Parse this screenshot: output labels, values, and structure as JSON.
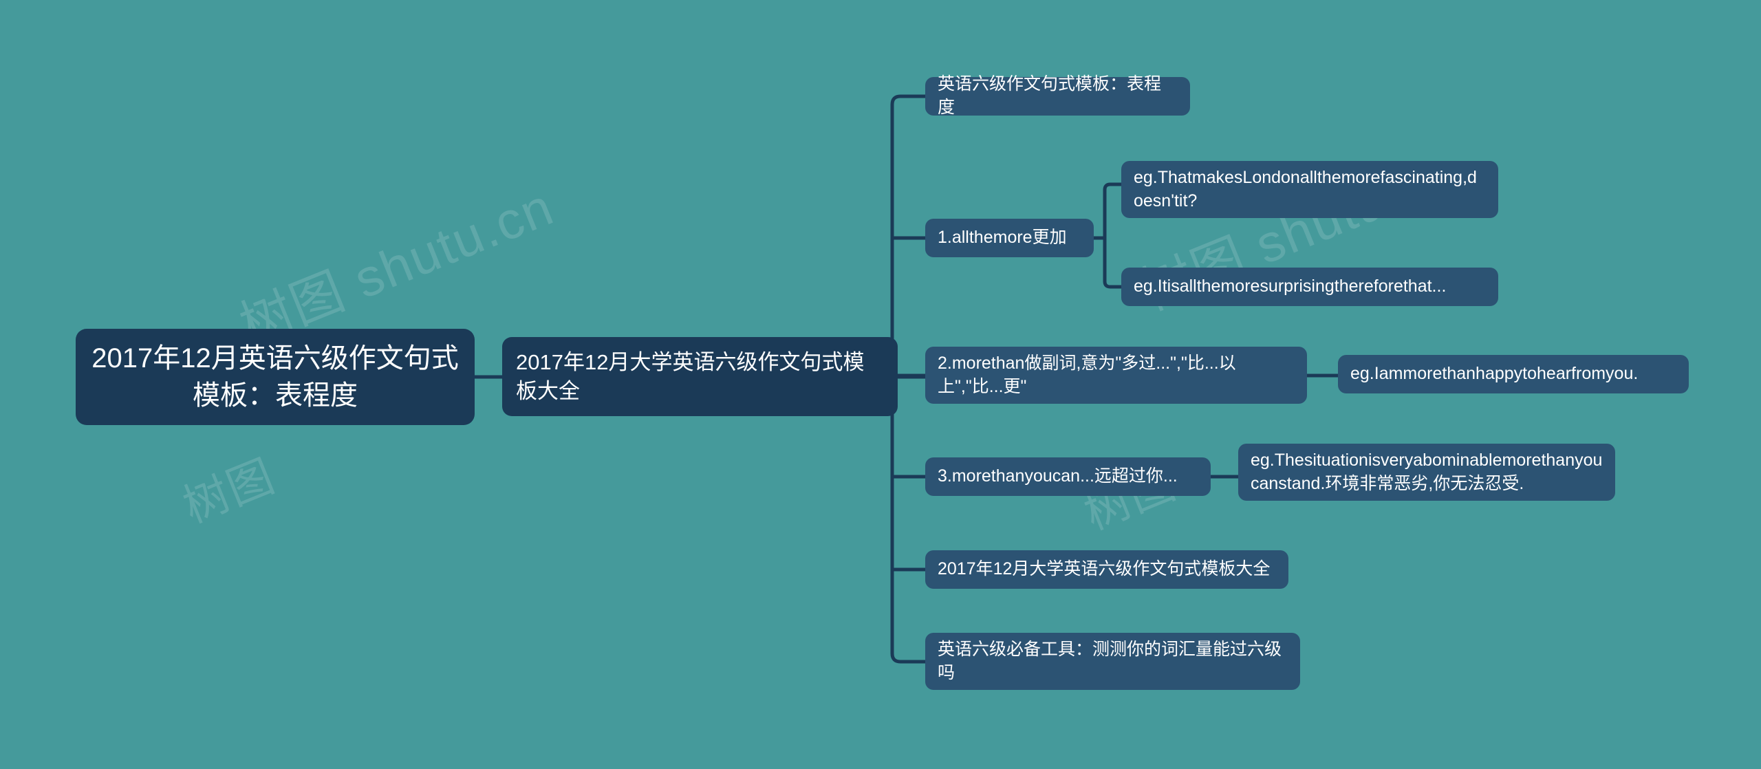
{
  "canvas": {
    "background_color": "#459a9b",
    "root_node_color": "#1b3a57",
    "branch_node_color": "#2c5373",
    "connector_color": "#1b3a57",
    "text_color": "#ffffff"
  },
  "watermark": {
    "text_cn": "树图",
    "text_en": "shutu.cn",
    "full": "树图 shutu.cn"
  },
  "mindmap": {
    "type": "mindmap",
    "root": {
      "id": "root",
      "label": "2017年12月英语六级作文句式模板：表程度"
    },
    "level2": {
      "id": "l2",
      "label": "2017年12月大学英语六级作文句式模板大全"
    },
    "branches": [
      {
        "id": "b1",
        "label": "英语六级作文句式模板：表程度",
        "children": []
      },
      {
        "id": "b2",
        "label": "1.allthemore更加",
        "children": [
          {
            "id": "b2c1",
            "label": "eg.ThatmakesLondonallthemorefascinating,doesn'tit?"
          },
          {
            "id": "b2c2",
            "label": "eg.Itisallthemoresurprisingthereforethat..."
          }
        ]
      },
      {
        "id": "b3",
        "label": "2.morethan做副词,意为\"多过...\",\"比...以上\",\"比...更\"",
        "children": [
          {
            "id": "b3c1",
            "label": "eg.Iammorethanhappytohearfromyou."
          }
        ]
      },
      {
        "id": "b4",
        "label": "3.morethanyoucan...远超过你...",
        "children": [
          {
            "id": "b4c1",
            "label": "eg.Thesituationisveryabominablemorethanyoucanstand.环境非常恶劣,你无法忍受."
          }
        ]
      },
      {
        "id": "b5",
        "label": "2017年12月大学英语六级作文句式模板大全",
        "children": []
      },
      {
        "id": "b6",
        "label": "英语六级必备工具：测测你的词汇量能过六级吗",
        "children": []
      }
    ]
  }
}
